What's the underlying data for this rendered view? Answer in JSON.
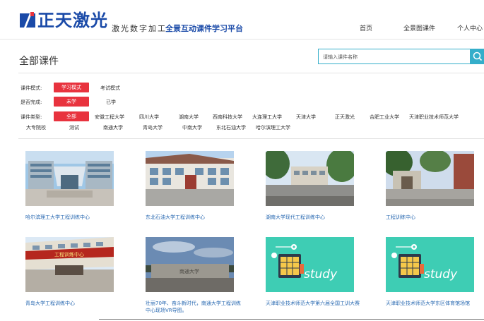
{
  "header": {
    "logo_text": "正天激光",
    "slogan": "激光数字加工",
    "slogan_em": "全景互动课件学习平台",
    "nav": [
      "首页",
      "全景图课件",
      "个人中心"
    ]
  },
  "page": {
    "title": "全部课件",
    "search_placeholder": "请输入课件名称"
  },
  "filters": {
    "mode": {
      "label": "课件模式:",
      "options": [
        "学习模式",
        "考试模式"
      ],
      "selected": "学习模式"
    },
    "done": {
      "label": "是否完成:",
      "options": [
        "未学",
        "已学"
      ],
      "selected": "未学"
    },
    "type": {
      "label": "课件类型:",
      "row1": [
        "全部",
        "安徽工程大学",
        "四川大学",
        "湖南大学",
        "西南科技大学",
        "大连理工大学",
        "天津大学",
        "正天激光",
        "合肥工业大学",
        "天津职业技术师范大学"
      ],
      "row2": [
        "大专院校",
        "测试",
        "南通大学",
        "青岛大学",
        "中南大学",
        "东北石油大学",
        "哈尔滨理工大学"
      ],
      "selected": "全部"
    }
  },
  "cards": [
    {
      "title": "哈尔滨理工大学工程训练中心"
    },
    {
      "title": "东北石油大学工程训练中心"
    },
    {
      "title": "湖南大学现代工程训练中心"
    },
    {
      "title": "工程训练中心"
    },
    {
      "title": "青岛大学工程训练中心",
      "sign_text": "工程训练中心"
    },
    {
      "title_line1": "壮丽70年、奋斗新时代，南通大学工程训练",
      "title_line2": "中心现场VR导图。",
      "stone_text": "南通大学"
    },
    {
      "title": "天津职业技术师范大学第六届全国工训大赛",
      "study_text": "study"
    },
    {
      "title": "天津职业技术师范大学东区体育馆场馆",
      "study_text": "study"
    }
  ],
  "colors": {
    "brand_blue": "#1a4aa8",
    "accent_red": "#e8333e",
    "search_teal": "#35aeca",
    "link_blue": "#2a6ab2",
    "study_bg": "#3ecdb4"
  }
}
